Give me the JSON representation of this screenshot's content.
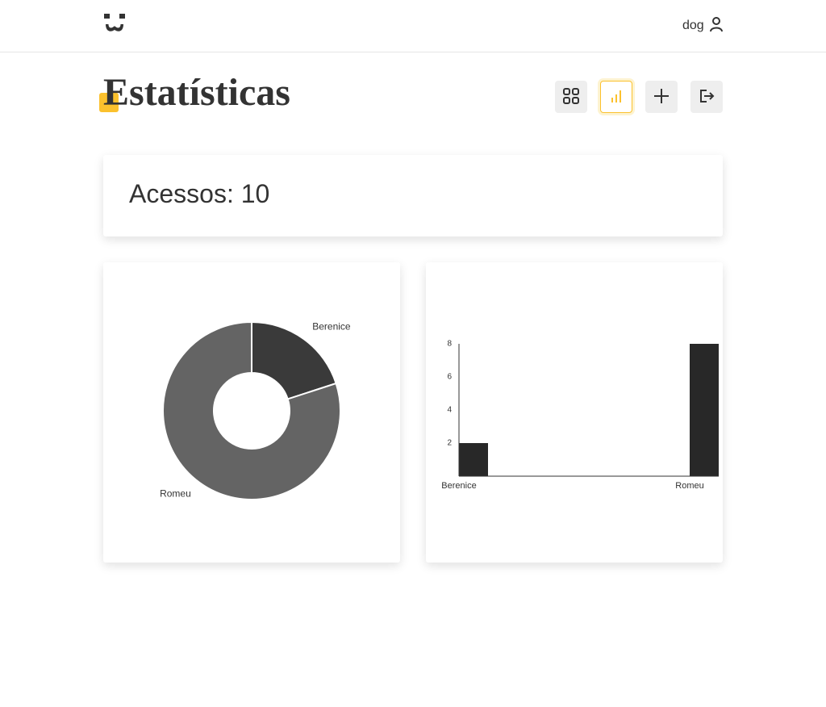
{
  "header": {
    "logo_icon": "dog-face-icon",
    "username": "dog",
    "user_icon": "user-icon"
  },
  "page": {
    "title": "Estatísticas",
    "accent_color": "#fbc12d"
  },
  "nav": {
    "items": [
      {
        "icon": "grid-icon",
        "active": false
      },
      {
        "icon": "bar-chart-icon",
        "active": true
      },
      {
        "icon": "plus-icon",
        "active": false
      },
      {
        "icon": "logout-icon",
        "active": false
      }
    ]
  },
  "stats": {
    "accesses_text": "Acessos: 10"
  },
  "chart_data": [
    {
      "type": "pie",
      "donut": true,
      "categories": [
        "Berenice",
        "Romeu"
      ],
      "values": [
        2,
        8
      ],
      "colors": [
        "#3a3a3a",
        "#646464"
      ]
    },
    {
      "type": "bar",
      "categories": [
        "Berenice",
        "Romeu"
      ],
      "values": [
        2,
        8
      ],
      "yticks": [
        2,
        4,
        6,
        8
      ],
      "ylim": [
        0,
        8
      ],
      "bar_color": "#282828"
    }
  ]
}
